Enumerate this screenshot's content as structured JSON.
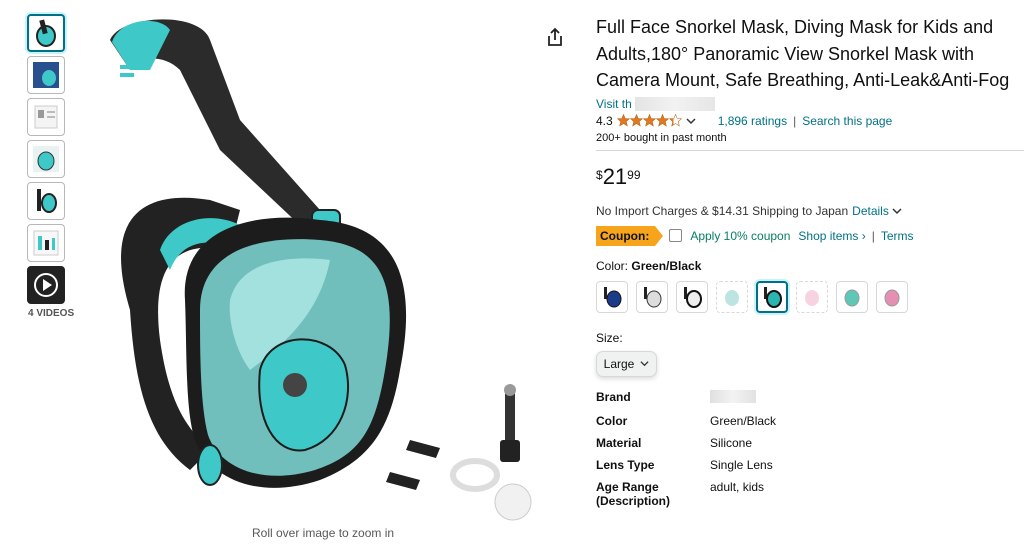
{
  "gallery": {
    "thumb_count": 7,
    "video_label": "4 VIDEOS",
    "zoom_hint": "Roll over image to zoom in"
  },
  "product": {
    "title": "Full Face Snorkel Mask, Diving Mask for Kids and Adults,180° Panoramic View Snorkel Mask with Camera Mount, Safe Breathing, Anti-Leak&Anti-Fog",
    "visit_prefix": "Visit th",
    "rating_value": "4.3",
    "rating_stars": 4.3,
    "ratings_count": "1,896 ratings",
    "search_page": "Search this page",
    "bought": "200+ bought in past month"
  },
  "price": {
    "symbol": "$",
    "whole": "21",
    "fraction": "99"
  },
  "shipping": {
    "text": "No Import Charges & $14.31 Shipping to Japan",
    "details_label": "Details"
  },
  "coupon": {
    "badge": "Coupon:",
    "apply": "Apply 10% coupon",
    "shop_items": "Shop items ›",
    "separator": "|",
    "terms": "Terms"
  },
  "color": {
    "label": "Color:",
    "selected": "Green/Black",
    "swatch_colors": [
      "#1b3a8a",
      "#333333",
      "#222222",
      "#8fd3cf",
      "#2bb5b1",
      "#f2b6cf",
      "#5fc7b6",
      "#e48fb3"
    ]
  },
  "size": {
    "label": "Size:",
    "selected": "Large"
  },
  "specs": [
    {
      "key": "Brand",
      "value": ""
    },
    {
      "key": "Color",
      "value": "Green/Black"
    },
    {
      "key": "Material",
      "value": "Silicone"
    },
    {
      "key": "Lens Type",
      "value": "Single Lens"
    },
    {
      "key": "Age Range (Description)",
      "value": "adult, kids"
    }
  ],
  "colors": {
    "link": "#007185",
    "coupon": "#f7a41d",
    "apply": "#067d62",
    "star": "#de7921",
    "mask_teal": "#3ec9c8"
  }
}
